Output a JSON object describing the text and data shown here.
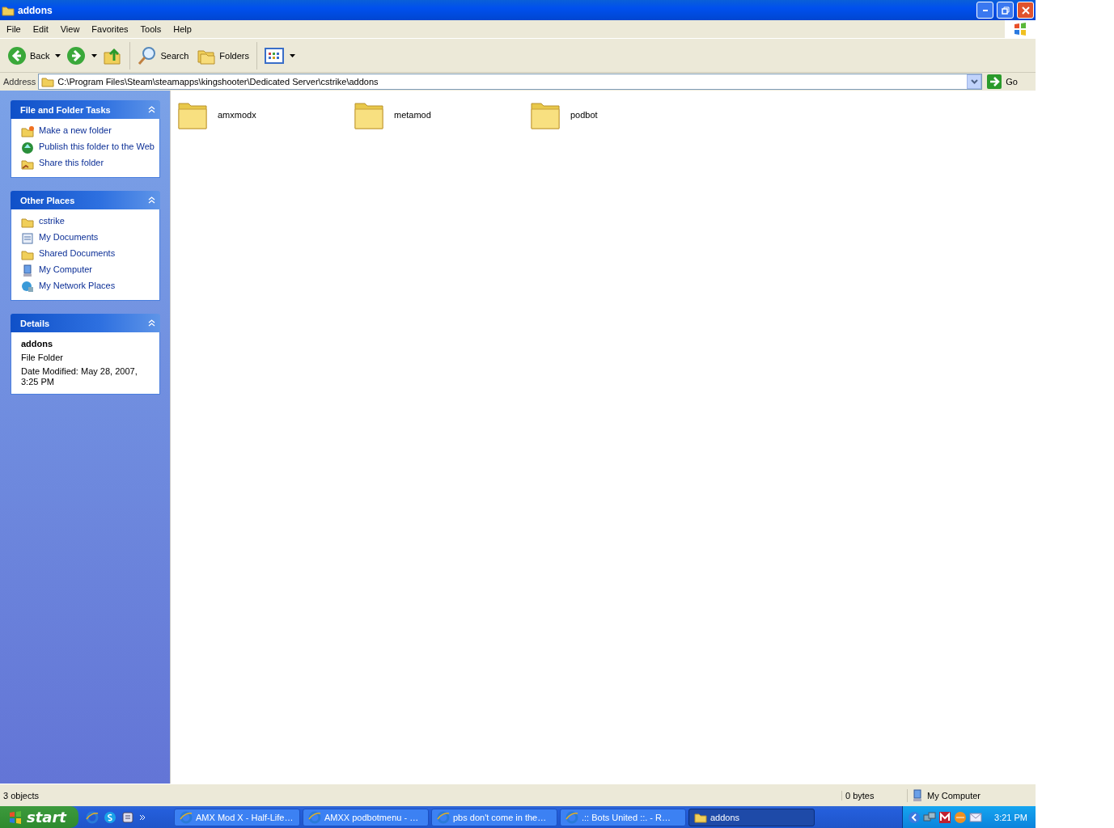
{
  "window": {
    "title": "addons"
  },
  "menu": [
    "File",
    "Edit",
    "View",
    "Favorites",
    "Tools",
    "Help"
  ],
  "toolbar": [
    {
      "kind": "back",
      "label": "Back",
      "dropdown": true
    },
    {
      "kind": "forward",
      "dropdown": true
    },
    {
      "kind": "up"
    },
    {
      "kind": "search",
      "label": "Search"
    },
    {
      "kind": "folders",
      "label": "Folders"
    },
    {
      "kind": "views",
      "dropdown": true
    }
  ],
  "address": {
    "label": "Address",
    "path": "C:\\Program Files\\Steam\\steamapps\\kingshooter\\Dedicated Server\\cstrike\\addons",
    "go": "Go"
  },
  "sidebar": {
    "panels": [
      {
        "title": "File and Folder Tasks",
        "expanded": true,
        "items": [
          {
            "kind": "new-folder",
            "label": "Make a new folder"
          },
          {
            "kind": "globe",
            "label": "Publish this folder to the Web"
          },
          {
            "kind": "share-folder",
            "label": "Share this folder"
          }
        ]
      },
      {
        "title": "Other Places",
        "expanded": true,
        "items": [
          {
            "kind": "folder",
            "label": "cstrike"
          },
          {
            "kind": "documents",
            "label": "My Documents"
          },
          {
            "kind": "folder",
            "label": "Shared Documents"
          },
          {
            "kind": "computer",
            "label": "My Computer"
          },
          {
            "kind": "network",
            "label": "My Network Places"
          }
        ]
      },
      {
        "title": "Details",
        "expanded": true,
        "details": {
          "name": "addons",
          "type": "File Folder",
          "modified": "Date Modified: May 28, 2007, 3:25 PM"
        }
      }
    ]
  },
  "files": [
    {
      "name": "amxmodx",
      "selected": false
    },
    {
      "name": "metamod",
      "selected": false
    },
    {
      "name": "podbot",
      "selected": false
    }
  ],
  "status_bar": {
    "objects": "3 objects",
    "size": "0 bytes",
    "zone": "My Computer"
  },
  "taskbar": {
    "start": "start",
    "quick_launch": [
      {
        "kind": "ie"
      },
      {
        "kind": "skype"
      },
      {
        "kind": "app"
      }
    ],
    "tasks": [
      {
        "kind": "ie",
        "label": "AMX Mod X - Half-Life…",
        "selected": false
      },
      {
        "kind": "ie",
        "label": "AMXX podbotmenu - …",
        "selected": false
      },
      {
        "kind": "ie",
        "label": "pbs don't come in the…",
        "selected": false
      },
      {
        "kind": "ie",
        "label": ".:: Bots United ::. - R…",
        "selected": false
      },
      {
        "kind": "folder",
        "label": "addons",
        "selected": true
      }
    ],
    "tray": [
      {
        "kind": "back"
      },
      {
        "kind": "network"
      },
      {
        "kind": "m"
      },
      {
        "kind": "messenger"
      },
      {
        "kind": "mail"
      }
    ],
    "clock": "3:21 PM"
  }
}
